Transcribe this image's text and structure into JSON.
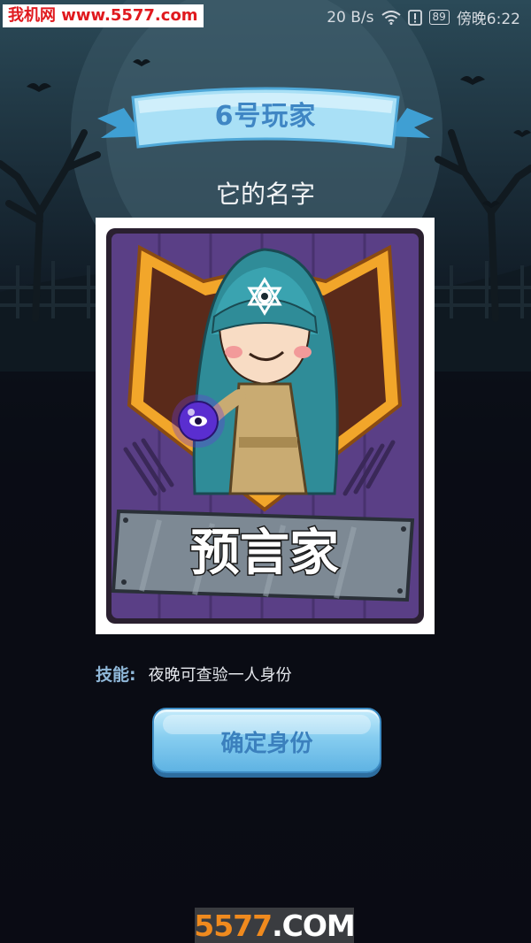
{
  "status_bar": {
    "watermark": "我机网 www.5577.com",
    "network_speed": "20 B/s",
    "battery_level": "89",
    "time": "傍晚6:22",
    "icons": [
      "wifi-icon",
      "alert-icon",
      "battery-icon"
    ]
  },
  "header": {
    "ribbon_title": "6号玩家",
    "player_name": "它的名字"
  },
  "card": {
    "role_name": "预言家",
    "icons": [
      "seer-character-icon",
      "crystal-ball-icon",
      "eye-symbol-icon"
    ]
  },
  "skill": {
    "label": "技能:",
    "description": "夜晚可查验一人身份"
  },
  "actions": {
    "confirm_label": "确定身份"
  },
  "footer": {
    "watermark_digits": "5577",
    "watermark_suffix": ".COM"
  },
  "colors": {
    "ribbon_blue": "#6ec3ea",
    "ribbon_text": "#3f86c4",
    "card_purple": "#5a3f86",
    "frame_gold": "#f2a62a",
    "button_blue": "#86cdf0",
    "watermark_red": "#e0191e",
    "watermark_orange": "#f08a1e"
  }
}
